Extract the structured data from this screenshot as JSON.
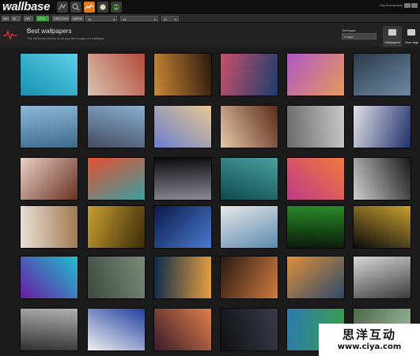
{
  "app": {
    "logo": "wallbase"
  },
  "top_nav": {
    "icons": [
      {
        "name": "random-icon",
        "color": "#3a3a3a"
      },
      {
        "name": "search-icon",
        "color": "#3a3a3a"
      },
      {
        "name": "toplist-icon",
        "color": "#e07a1c"
      },
      {
        "name": "favorites-icon",
        "color": "#3a3a3a"
      },
      {
        "name": "alien-icon",
        "color": "#3a3a3a"
      }
    ],
    "account_text": "Hey Anonymous"
  },
  "filter_bar": {
    "chips": [
      {
        "label": "WG",
        "color": "#555555"
      },
      {
        "label": "W",
        "color": "#555555"
      },
      {
        "label": "HR",
        "color": "#555555"
      },
      {
        "label": "SFW",
        "color": "#3f9b3f"
      },
      {
        "label": "SKETCHY",
        "color": "#555555"
      },
      {
        "label": "NSFW",
        "color": "#555555"
      }
    ],
    "selects": [
      {
        "value": "All"
      },
      {
        "value": "All"
      },
      {
        "value": "32"
      }
    ]
  },
  "header": {
    "title": "Best wallpapers",
    "subtitle": "The list below shows most popular images on wallbase",
    "timespan_label": "Timespan:",
    "timespan_value": "3 days",
    "tabs": [
      {
        "label": "Wallpapers",
        "active": true
      },
      {
        "label": "User tags",
        "active": false
      }
    ]
  },
  "grid": {
    "thumbnails": [
      {
        "name": "woman-pool",
        "c1": "#1a8fb0",
        "c2": "#5ad0e8"
      },
      {
        "name": "redhead-bed",
        "c1": "#d8c3b0",
        "c2": "#b54a3a"
      },
      {
        "name": "sunset-clouds",
        "c1": "#c98a34",
        "c2": "#2e1a0e"
      },
      {
        "name": "ocean-sunset",
        "c1": "#c8506a",
        "c2": "#1c3e6e"
      },
      {
        "name": "purple-abstract",
        "c1": "#b057c8",
        "c2": "#e69a5a"
      },
      {
        "name": "dark-nebula",
        "c1": "#2a3a4a",
        "c2": "#6f8aa4"
      },
      {
        "name": "snowy-mountains",
        "c1": "#8fb8d8",
        "c2": "#3e6a8a"
      },
      {
        "name": "mask-figure",
        "c1": "#444a60",
        "c2": "#8ab0d0"
      },
      {
        "name": "anime-beach",
        "c1": "#6a7ed0",
        "c2": "#e6c890"
      },
      {
        "name": "fantasy-girl",
        "c1": "#e6c8a8",
        "c2": "#5a2a1a"
      },
      {
        "name": "castle-fog",
        "c1": "#6a6a6a",
        "c2": "#c8c8c8"
      },
      {
        "name": "anime-warrior",
        "c1": "#e0e0e8",
        "c2": "#20306a"
      },
      {
        "name": "brunette-portrait",
        "c1": "#e8d0c8",
        "c2": "#6a3020"
      },
      {
        "name": "colorful-feathers",
        "c1": "#e85030",
        "c2": "#38a0a0"
      },
      {
        "name": "astronaut-helmet",
        "c1": "#0a0a0e",
        "c2": "#8a8a92"
      },
      {
        "name": "dragon-teal",
        "c1": "#0e4a4e",
        "c2": "#4aa0a0"
      },
      {
        "name": "purple-mountains",
        "c1": "#c03a8a",
        "c2": "#f07a3a"
      },
      {
        "name": "black-car",
        "c1": "#cfcfcf",
        "c2": "#1a1a1a"
      },
      {
        "name": "blonde-portrait",
        "c1": "#e8e0d8",
        "c2": "#a07a50"
      },
      {
        "name": "minions-crowd",
        "c1": "#c8a030",
        "c2": "#3a2a0a"
      },
      {
        "name": "galaxy-spiral",
        "c1": "#0a1a4a",
        "c2": "#4a7ad0"
      },
      {
        "name": "mouse-ears-girl",
        "c1": "#e8e8e8",
        "c2": "#5a8ab0"
      },
      {
        "name": "green-code",
        "c1": "#0a1a0a",
        "c2": "#2a8a2a"
      },
      {
        "name": "daft-punk-helmets",
        "c1": "#0a0a0a",
        "c2": "#c8a030"
      },
      {
        "name": "neon-triangle",
        "c1": "#6a1aa0",
        "c2": "#20c0d0"
      },
      {
        "name": "ruined-city",
        "c1": "#3a4a40",
        "c2": "#7a8a7a"
      },
      {
        "name": "shattered-glass",
        "c1": "#0a2a4a",
        "c2": "#e8a040"
      },
      {
        "name": "cosmic-explosion",
        "c1": "#2a1a10",
        "c2": "#d07a40"
      },
      {
        "name": "sunset-lake",
        "c1": "#e0903a",
        "c2": "#2a4a6a"
      },
      {
        "name": "mech-robot",
        "c1": "#d8d8d8",
        "c2": "#3a3a3a"
      },
      {
        "name": "woman-doorway",
        "c1": "#303030",
        "c2": "#b0b0b0"
      },
      {
        "name": "superman-comic",
        "c1": "#f0f0f0",
        "c2": "#2040a0"
      },
      {
        "name": "bokeh-lights",
        "c1": "#3a1a2a",
        "c2": "#e0804a"
      },
      {
        "name": "dark-horizon",
        "c1": "#101014",
        "c2": "#3a3a4a"
      },
      {
        "name": "tropical-island",
        "c1": "#2a7ab0",
        "c2": "#3aa04a"
      },
      {
        "name": "last-partial",
        "c1": "#4a6a4a",
        "c2": "#a0c0a0"
      }
    ]
  },
  "watermark": {
    "line1": "思洋互动",
    "line2": "www.ciya.com"
  }
}
